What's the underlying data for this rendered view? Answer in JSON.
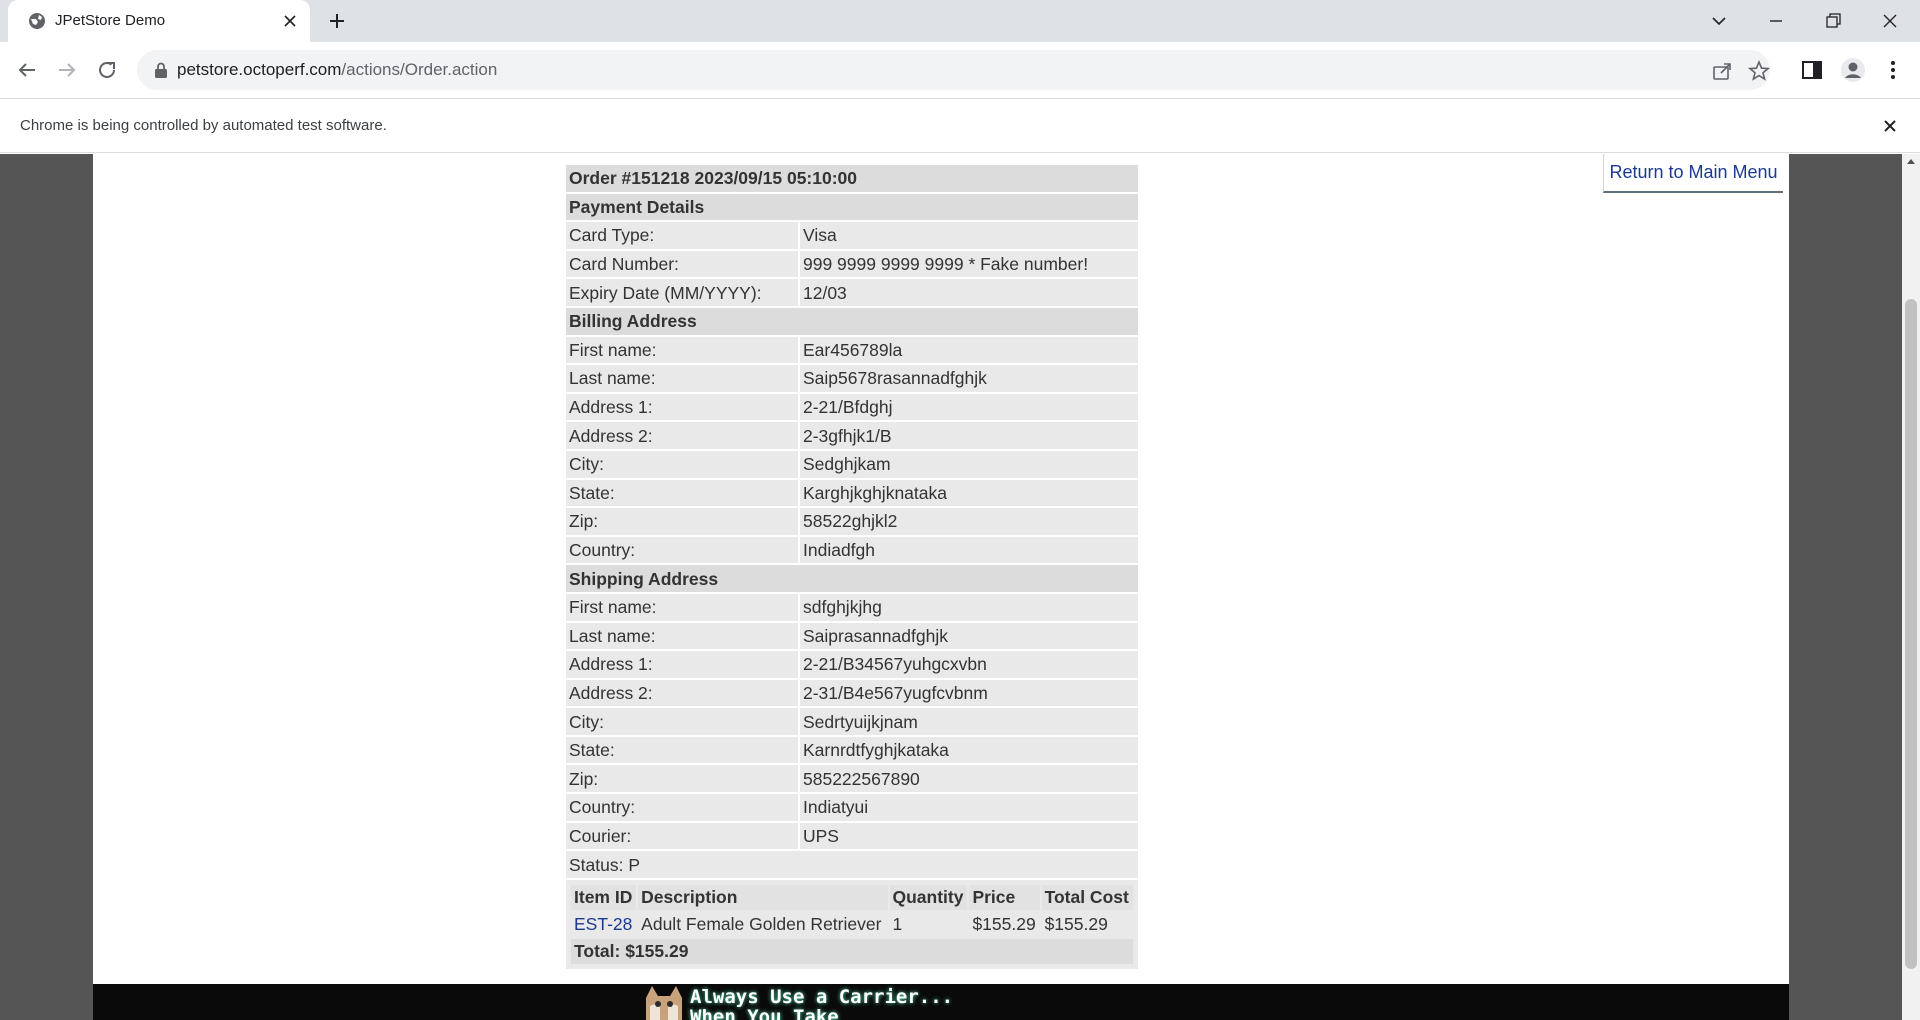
{
  "browser": {
    "tab_title": "JPetStore Demo",
    "url_host": "petstore.octoperf.com",
    "url_path": "/actions/Order.action",
    "infobar_text": "Chrome is being controlled by automated test software."
  },
  "page": {
    "return_link": "Return to Main Menu",
    "order_header": "Order #151218 2023/09/15 05:10:00",
    "payment": {
      "heading": "Payment Details",
      "rows": [
        {
          "label": "Card Type:",
          "value": "Visa"
        },
        {
          "label": "Card Number:",
          "value": "999 9999 9999 9999 * Fake number!"
        },
        {
          "label": "Expiry Date (MM/YYYY):",
          "value": "12/03"
        }
      ]
    },
    "billing": {
      "heading": "Billing Address",
      "rows": [
        {
          "label": "First name:",
          "value": "Ear456789la"
        },
        {
          "label": "Last name:",
          "value": "Saip5678rasannadfghjk"
        },
        {
          "label": "Address 1:",
          "value": "2-21/Bfdghj"
        },
        {
          "label": "Address 2:",
          "value": "2-3gfhjk1/B"
        },
        {
          "label": "City:",
          "value": "Sedghjkam"
        },
        {
          "label": "State:",
          "value": "Karghjkghjknataka"
        },
        {
          "label": "Zip:",
          "value": "58522ghjkl2"
        },
        {
          "label": "Country:",
          "value": "Indiadfgh"
        }
      ]
    },
    "shipping": {
      "heading": "Shipping Address",
      "rows": [
        {
          "label": "First name:",
          "value": "sdfghjkjhg"
        },
        {
          "label": "Last name:",
          "value": "Saiprasannadfghjk"
        },
        {
          "label": "Address 1:",
          "value": "2-21/B34567yuhgcxvbn"
        },
        {
          "label": "Address 2:",
          "value": "2-31/B4e567yugfcvbnm"
        },
        {
          "label": "City:",
          "value": "Sedrtyuijkjnam"
        },
        {
          "label": "State:",
          "value": "Karnrdtfyghjkataka"
        },
        {
          "label": "Zip:",
          "value": "585222567890"
        },
        {
          "label": "Country:",
          "value": "Indiatyui"
        },
        {
          "label": "Courier:",
          "value": "UPS"
        }
      ]
    },
    "status": "Status: P",
    "items": {
      "headers": [
        "Item ID",
        "Description",
        "Quantity",
        "Price",
        "Total Cost"
      ],
      "rows": [
        {
          "item_id": "EST-28",
          "description": "Adult Female Golden Retriever",
          "quantity": "1",
          "price": "$155.29",
          "total_cost": "$155.29"
        }
      ],
      "total": "Total: $155.29"
    },
    "banner_line1": "Always Use a Carrier...",
    "banner_line2": "When You Take"
  },
  "icons": {
    "favicon": "globe-icon",
    "tab_close": "close-icon",
    "new_tab": "plus-icon",
    "back": "arrow-left-icon",
    "forward": "arrow-right-icon",
    "reload": "reload-icon",
    "lock": "lock-icon",
    "share": "share-icon",
    "bookmark": "star-icon",
    "side_panel": "side-panel-icon",
    "profile": "profile-icon",
    "menu": "kebab-menu-icon"
  },
  "colors": {
    "link": "#1a3a8f",
    "cell_bg": "#e9e9e9",
    "page_bg": "#555555"
  }
}
